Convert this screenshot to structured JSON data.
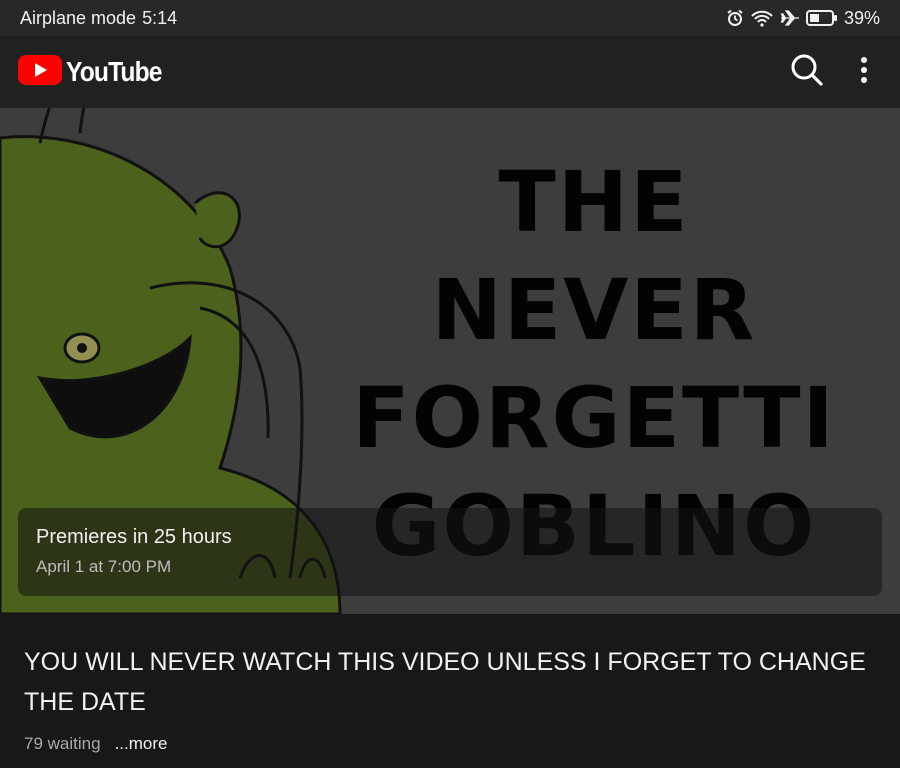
{
  "status_bar": {
    "mode": "Airplane mode",
    "time": "5:14",
    "battery": "39%",
    "icons": [
      "alarm-icon",
      "wifi-icon",
      "airplane-icon",
      "battery-icon"
    ]
  },
  "app": {
    "logo_text": "YouTube",
    "brand_color": "#ff0000",
    "actions": [
      "search-icon",
      "more-vert-icon"
    ]
  },
  "thumbnail": {
    "title_lines": [
      "THE",
      "NEVER",
      "FORGETTI",
      "GOBLINO"
    ]
  },
  "premiere": {
    "countdown": "Premieres in 25 hours",
    "date": "April 1 at 7:00 PM"
  },
  "video": {
    "title": "YOU WILL NEVER WATCH THIS VIDEO UNLESS I FORGET TO CHANGE THE DATE",
    "waiting": "79 waiting",
    "more_label": "...more"
  }
}
